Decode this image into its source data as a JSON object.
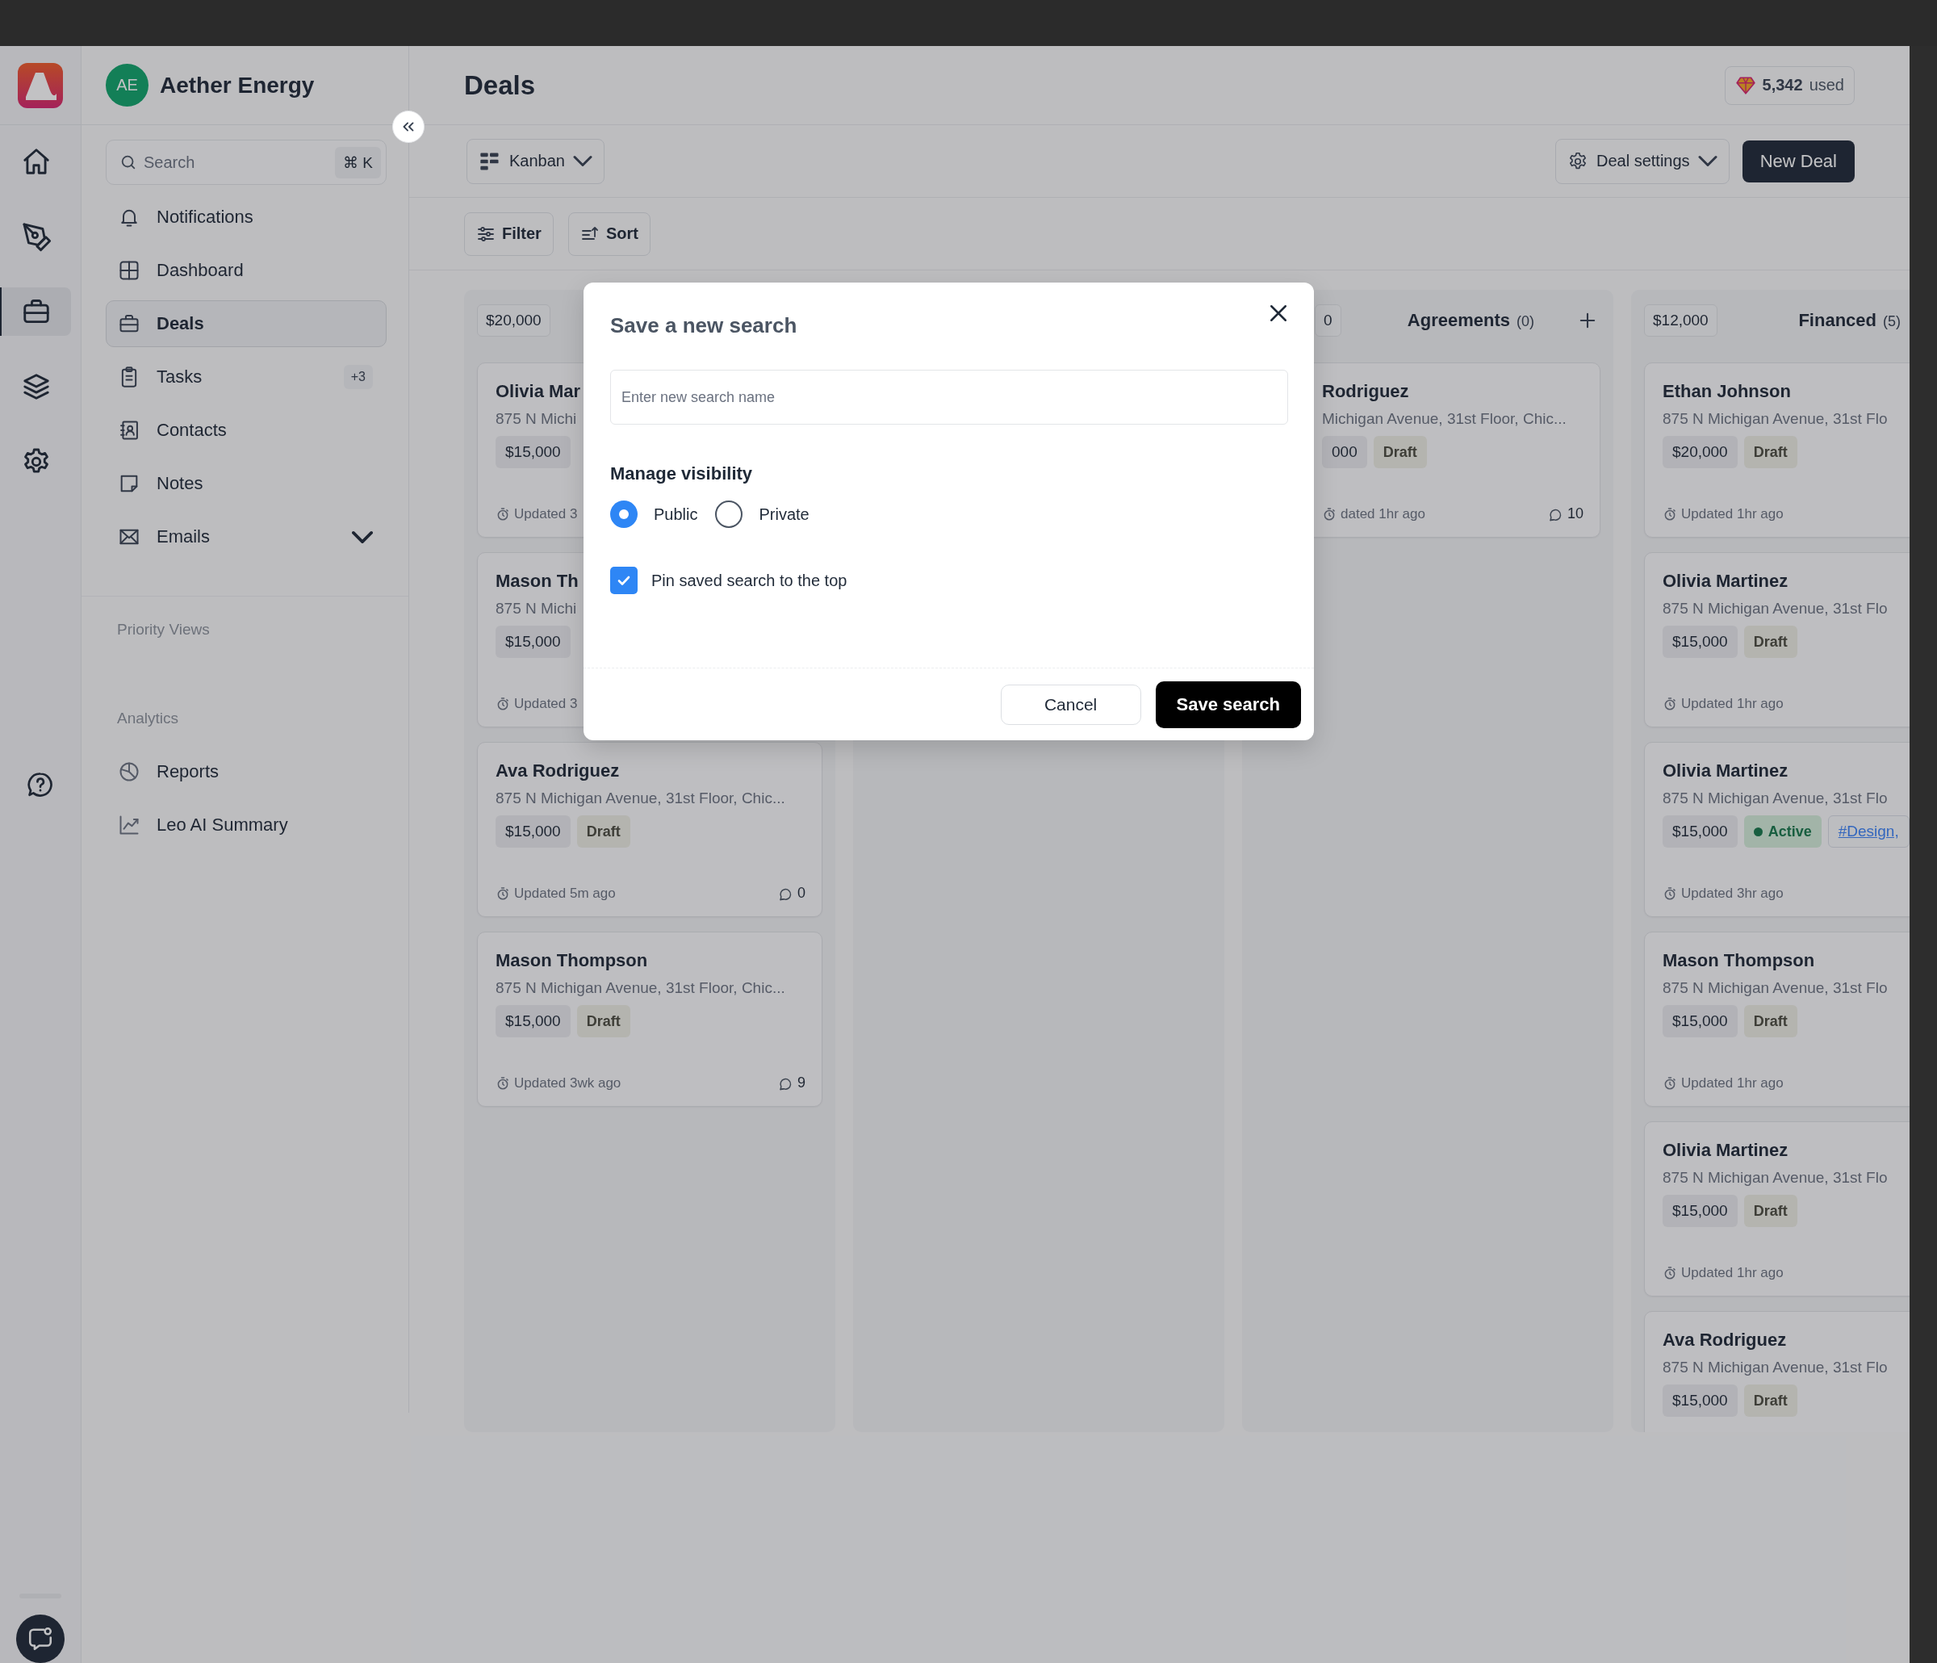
{
  "rail": [
    {
      "selected": false
    },
    {
      "selected": false
    },
    {
      "selected": true
    },
    {
      "selected": false
    },
    {
      "selected": false
    }
  ],
  "workspace": {
    "initials": "AE",
    "name": "Aether Energy"
  },
  "search": {
    "placeholder": "Search",
    "shortcut": "⌘ K"
  },
  "nav": [
    {
      "label": "Notifications",
      "selected": false
    },
    {
      "label": "Dashboard",
      "selected": false
    },
    {
      "label": "Deals",
      "selected": true
    },
    {
      "label": "Tasks",
      "selected": false,
      "badge": "+3"
    },
    {
      "label": "Contacts",
      "selected": false
    },
    {
      "label": "Notes",
      "selected": false
    },
    {
      "label": "Emails",
      "selected": false,
      "expanded": false
    }
  ],
  "sections": [
    {
      "title": "Priority Views"
    },
    {
      "title": "Analytics",
      "items": [
        {
          "label": "Reports"
        },
        {
          "label": "Leo AI Summary"
        }
      ]
    }
  ],
  "page": {
    "title": "Deals",
    "usage": {
      "count": "5,342",
      "unit": "used"
    }
  },
  "toolbar": {
    "view": "Kanban",
    "settings": "Deal settings",
    "primary": "New Deal",
    "filter": "Filter",
    "sort": "Sort"
  },
  "columns": [
    {
      "amount": "$20,000",
      "cards": [
        {
          "name": "Olivia Mar",
          "address": "875 N Michi",
          "tags": [
            {
              "kind": "amount",
              "text": "$15,000"
            }
          ],
          "updated": "Updated 3"
        },
        {
          "name": "Mason Th",
          "address": "875 N Michi",
          "tags": [
            {
              "kind": "amount",
              "text": "$15,000"
            }
          ],
          "updated": "Updated 3"
        },
        {
          "name": "Ava Rodriguez",
          "address": "875 N Michigan Avenue, 31st Floor, Chic...",
          "tags": [
            {
              "kind": "amount",
              "text": "$15,000"
            },
            {
              "kind": "draft",
              "text": "Draft"
            }
          ],
          "updated": "Updated 5m ago",
          "comments": "0"
        },
        {
          "name": "Mason Thompson",
          "address": "875 N Michigan Avenue, 31st Floor, Chic...",
          "tags": [
            {
              "kind": "amount",
              "text": "$15,000"
            },
            {
              "kind": "draft",
              "text": "Draft"
            }
          ],
          "updated": "Updated 3wk ago",
          "comments": "9"
        }
      ]
    },
    {},
    {
      "amount": "0",
      "title": "Agreements",
      "count": "(0)",
      "add_button": true,
      "cards": [
        {
          "name": "Rodriguez",
          "address": "Michigan Avenue, 31st Floor, Chic...",
          "tags": [
            {
              "kind": "amount",
              "text": "000"
            },
            {
              "kind": "draft",
              "text": "Draft"
            }
          ],
          "updated": "dated 1hr ago",
          "comments": "10"
        }
      ]
    },
    {
      "amount": "$12,000",
      "title": "Financed",
      "count": "(5)",
      "cards": [
        {
          "name": "Ethan Johnson",
          "address": "875 N Michigan Avenue, 31st Flo",
          "tags": [
            {
              "kind": "amount",
              "text": "$20,000"
            },
            {
              "kind": "draft",
              "text": "Draft"
            }
          ],
          "updated": "Updated 1hr ago"
        },
        {
          "name": "Olivia Martinez",
          "address": "875 N Michigan Avenue, 31st Flo",
          "tags": [
            {
              "kind": "amount",
              "text": "$15,000"
            },
            {
              "kind": "draft",
              "text": "Draft"
            }
          ],
          "updated": "Updated 1hr ago"
        },
        {
          "name": "Olivia Martinez",
          "address": "875 N Michigan Avenue, 31st Flo",
          "tags": [
            {
              "kind": "amount",
              "text": "$15,000"
            },
            {
              "kind": "active",
              "text": "Active"
            },
            {
              "kind": "link",
              "text": "#Design,"
            }
          ],
          "updated": "Updated 3hr ago"
        },
        {
          "name": "Mason Thompson",
          "address": "875 N Michigan Avenue, 31st Flo",
          "tags": [
            {
              "kind": "amount",
              "text": "$15,000"
            },
            {
              "kind": "draft",
              "text": "Draft"
            }
          ],
          "updated": "Updated 1hr ago"
        },
        {
          "name": "Olivia Martinez",
          "address": "875 N Michigan Avenue, 31st Flo",
          "tags": [
            {
              "kind": "amount",
              "text": "$15,000"
            },
            {
              "kind": "draft",
              "text": "Draft"
            }
          ],
          "updated": "Updated 1hr ago"
        },
        {
          "name": "Ava Rodriguez",
          "address": "875 N Michigan Avenue, 31st Flo",
          "tags": [
            {
              "kind": "amount",
              "text": "$15,000"
            },
            {
              "kind": "draft",
              "text": "Draft"
            }
          ]
        }
      ]
    }
  ],
  "modal": {
    "title": "Save a new search",
    "input": {
      "placeholder": "Enter new search name"
    },
    "visibility_label": "Manage visibility",
    "options": [
      {
        "label": "Public",
        "selected": true
      },
      {
        "label": "Private",
        "selected": false
      }
    ],
    "pin": {
      "label": "Pin saved search to the top",
      "checked": true
    },
    "buttons": [
      {
        "label": "Cancel",
        "kind": "secondary"
      },
      {
        "label": "Save search",
        "kind": "primary"
      }
    ]
  }
}
